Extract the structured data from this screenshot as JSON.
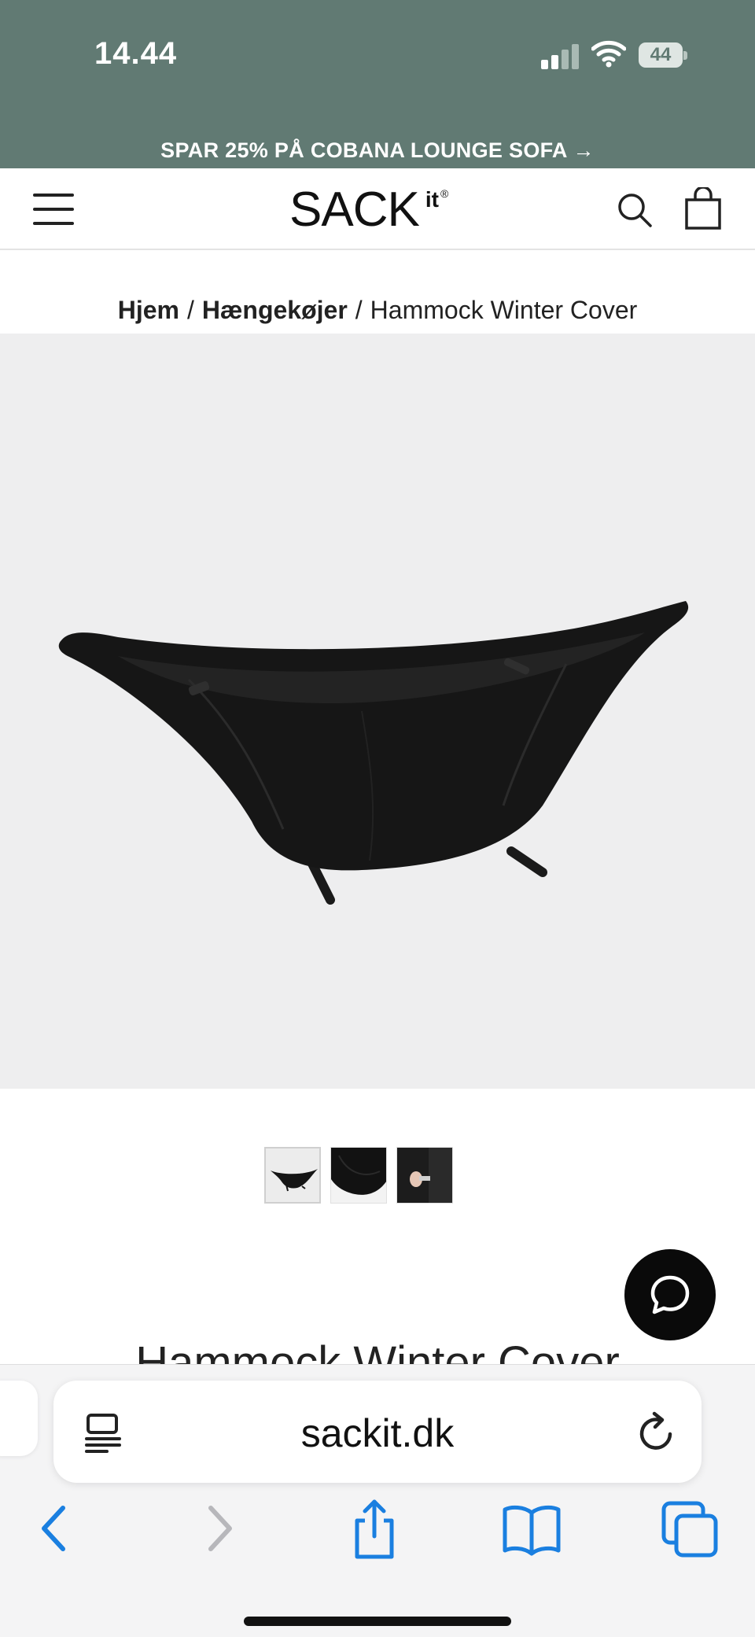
{
  "status_bar": {
    "time": "14.44",
    "battery": "44"
  },
  "promo": {
    "text": "SPAR 25% PÅ COBANA LOUNGE SOFA →"
  },
  "header": {
    "logo_text": "SACK",
    "logo_suffix": "it",
    "logo_mark": "®"
  },
  "breadcrumb": {
    "items": [
      {
        "label": "Hjem",
        "link": true
      },
      {
        "label": "Hængekøjer",
        "link": true
      },
      {
        "label": "Hammock Winter Cover",
        "link": false
      }
    ],
    "separator": "/"
  },
  "product": {
    "title": "Hammock Winter Cover",
    "thumbnails": [
      {
        "icon": "hammock-cover-thumbnail",
        "active": true
      },
      {
        "icon": "cover-closeup-thumbnail",
        "active": false
      },
      {
        "icon": "cover-strap-thumbnail",
        "active": false
      }
    ]
  },
  "safari": {
    "url": "sackit.dk"
  },
  "colors": {
    "header_green": "#617a73",
    "image_background": "#eeeeef",
    "safari_accent": "#1a7fe0"
  }
}
